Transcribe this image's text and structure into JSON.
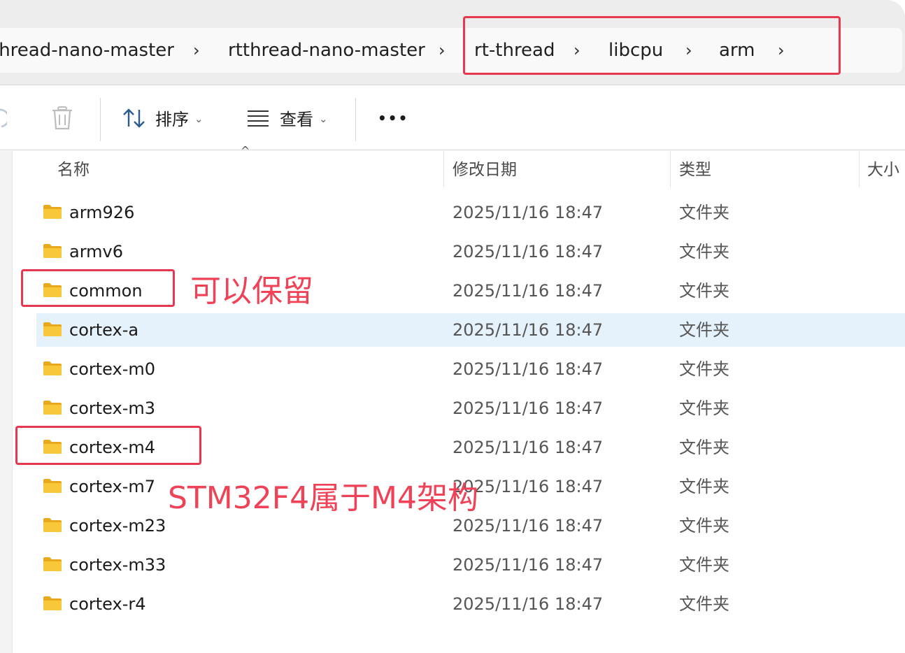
{
  "breadcrumb": {
    "items": [
      "thread-nano-master",
      "rtthread-nano-master",
      "rt-thread",
      "libcpu",
      "arm"
    ],
    "separator": "›"
  },
  "toolbar": {
    "sort_label": "排序",
    "view_label": "查看",
    "more_label": "•••"
  },
  "columns": {
    "name": "名称",
    "modified": "修改日期",
    "type": "类型",
    "size": "大小"
  },
  "files": [
    {
      "name": "arm926",
      "modified": "2025/11/16 18:47",
      "type": "文件夹"
    },
    {
      "name": "armv6",
      "modified": "2025/11/16 18:47",
      "type": "文件夹"
    },
    {
      "name": "common",
      "modified": "2025/11/16 18:47",
      "type": "文件夹"
    },
    {
      "name": "cortex-a",
      "modified": "2025/11/16 18:47",
      "type": "文件夹"
    },
    {
      "name": "cortex-m0",
      "modified": "2025/11/16 18:47",
      "type": "文件夹"
    },
    {
      "name": "cortex-m3",
      "modified": "2025/11/16 18:47",
      "type": "文件夹"
    },
    {
      "name": "cortex-m4",
      "modified": "2025/11/16 18:47",
      "type": "文件夹"
    },
    {
      "name": "cortex-m7",
      "modified": "2025/11/16 18:47",
      "type": "文件夹"
    },
    {
      "name": "cortex-m23",
      "modified": "2025/11/16 18:47",
      "type": "文件夹"
    },
    {
      "name": "cortex-m33",
      "modified": "2025/11/16 18:47",
      "type": "文件夹"
    },
    {
      "name": "cortex-r4",
      "modified": "2025/11/16 18:47",
      "type": "文件夹"
    }
  ],
  "selected_index": 3,
  "annotations": {
    "common_note": "可以保留",
    "m4_note": "STM32F4属于M4架构"
  },
  "colors": {
    "annotation": "#e8384f",
    "selection": "#e5f1fb",
    "folder": "#f8c83a"
  },
  "icons": {
    "toolbar": [
      "refresh-icon",
      "delete-icon",
      "sort-icon",
      "view-icon",
      "more-icon"
    ],
    "rows": "folder-icon"
  }
}
